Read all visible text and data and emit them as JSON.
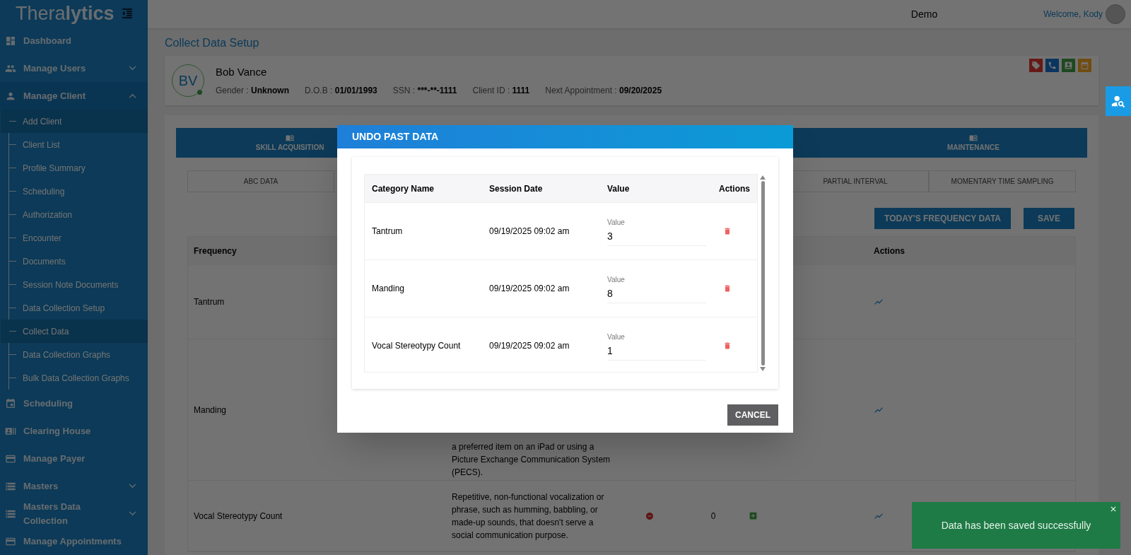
{
  "sidebar": {
    "logo": {
      "plain": "Thera",
      "bold": "lytics"
    },
    "items": [
      {
        "label": "Dashboard"
      },
      {
        "label": "Manage Users",
        "expanded": false
      },
      {
        "label": "Manage Client",
        "expanded": true,
        "children": [
          {
            "label": "Add Client",
            "selected": true
          },
          {
            "label": "Client List",
            "selected": false
          },
          {
            "label": "Profile Summary",
            "selected": false
          },
          {
            "label": "Scheduling",
            "selected": false
          },
          {
            "label": "Authorization",
            "selected": false
          },
          {
            "label": "Encounter",
            "selected": false
          },
          {
            "label": "Documents",
            "selected": false
          },
          {
            "label": "Session Note Documents",
            "selected": false
          },
          {
            "label": "Data Collection Setup",
            "selected": false
          },
          {
            "label": "Collect Data",
            "selected": true
          },
          {
            "label": "Data Collection Graphs",
            "selected": false
          },
          {
            "label": "Bulk Data Collection Graphs",
            "selected": false
          }
        ]
      },
      {
        "label": "Scheduling"
      },
      {
        "label": "Clearing House"
      },
      {
        "label": "Manage Payer"
      },
      {
        "label": "Masters",
        "expanded": false
      },
      {
        "label": "Masters Data Collection",
        "expanded": false
      },
      {
        "label": "Manage Appointments"
      }
    ]
  },
  "header": {
    "center": "Demo",
    "welcome": "Welcome, Kody"
  },
  "page_title": "Collect Data Setup",
  "client": {
    "initials": "BV",
    "name": "Bob Vance",
    "fields": [
      {
        "label": "Gender : ",
        "value": "Unknown"
      },
      {
        "label": "D.O.B : ",
        "value": "01/01/1993"
      },
      {
        "label": "SSN : ",
        "value": "***-**-1111"
      },
      {
        "label": "Client ID : ",
        "value": "1111"
      },
      {
        "label": "Next Appointment : ",
        "value": "09/20/2025"
      }
    ]
  },
  "main_tabs": [
    {
      "label": "SKILL ACQUISITION",
      "selected": false
    },
    {
      "label": "MAINTENANCE",
      "selected": false
    }
  ],
  "sub_tabs": [
    {
      "label": "ABC DATA",
      "selected": false
    },
    {
      "label": "PARTIAL INTERVAL",
      "selected": false
    },
    {
      "label": "MOMENTARY TIME SAMPLING",
      "selected": false
    }
  ],
  "buttons": [
    "TODAY'S FREQUENCY DATA",
    "SAVE"
  ],
  "table": {
    "columns": [
      "Frequency",
      "Actions"
    ],
    "rows": [
      {
        "name": "Tantrum"
      },
      {
        "name": "Manding",
        "description": "a preferred item on an iPad or using a Picture Exchange Communication System (PECS)."
      },
      {
        "name": "Vocal Stereotypy Count",
        "description": "Repetitive, non-functional vocalization or phrase, such as humming, babbling, or made-up sounds, that doesn't serve a social communication purpose.",
        "count": "0"
      }
    ]
  },
  "modal": {
    "title": "UNDO PAST DATA",
    "columns": [
      "Category Name",
      "Session Date",
      "Value",
      "Actions"
    ],
    "rows": [
      {
        "category": "Tantrum",
        "date": "09/19/2025 09:02 am",
        "value_label": "Value",
        "value": "3"
      },
      {
        "category": "Manding",
        "date": "09/19/2025 09:02 am",
        "value_label": "Value",
        "value": "8"
      },
      {
        "category": "Vocal Stereotypy Count",
        "date": "09/19/2025 09:02 am",
        "value_label": "Value",
        "value": "1"
      }
    ],
    "cancel": "CANCEL"
  },
  "toast": {
    "message": "Data has been saved successfully"
  }
}
